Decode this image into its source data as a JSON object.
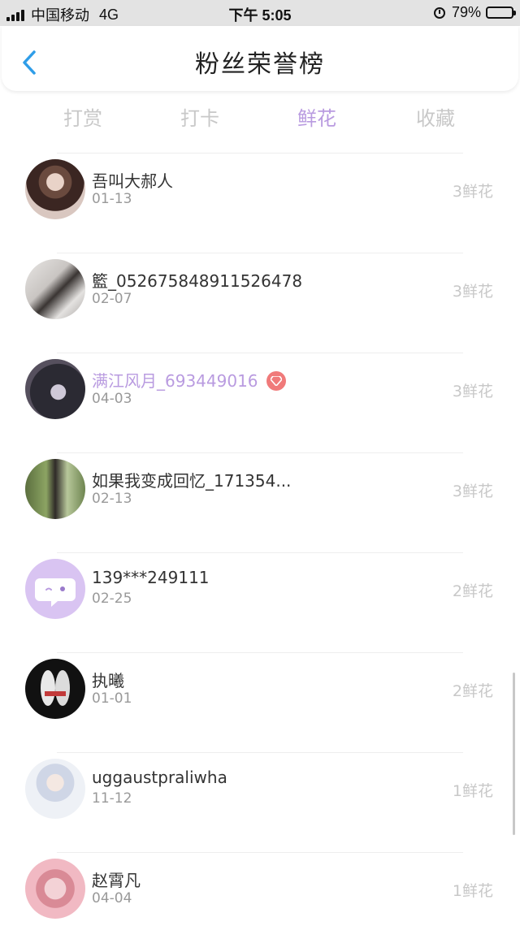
{
  "status_bar": {
    "carrier": "中国移动",
    "network": "4G",
    "time": "下午 5:05",
    "battery_percent": "79%",
    "battery_level": 0.79
  },
  "header": {
    "title": "粉丝荣誉榜",
    "back_icon": "chevron-left-icon",
    "accent_color": "#2f9de8"
  },
  "tabs": [
    {
      "label": "打赏",
      "active": false
    },
    {
      "label": "打卡",
      "active": false
    },
    {
      "label": "鲜花",
      "active": true
    },
    {
      "label": "收藏",
      "active": false
    }
  ],
  "colors": {
    "active_tab": "#b99be0",
    "inactive_text": "#c8c8c8",
    "vip_name": "#b99be0",
    "vip_badge": "#f07a7a"
  },
  "fans": [
    {
      "name": "吾叫大郝人",
      "date": "01-13",
      "count": "3鲜花",
      "vip": false
    },
    {
      "name": "籃_052675848911526478",
      "date": "02-07",
      "count": "3鲜花",
      "vip": false
    },
    {
      "name": "满江风月_693449016",
      "date": "04-03",
      "count": "3鲜花",
      "vip": true
    },
    {
      "name": "如果我变成回忆_171354...",
      "date": "02-13",
      "count": "3鲜花",
      "vip": false
    },
    {
      "name": "139***249111",
      "date": "02-25",
      "count": "2鲜花",
      "vip": false
    },
    {
      "name": "执曦",
      "date": "01-01",
      "count": "2鲜花",
      "vip": false
    },
    {
      "name": "uggaustpraliwha",
      "date": "11-12",
      "count": "1鲜花",
      "vip": false
    },
    {
      "name": "赵霄凡",
      "date": "04-04",
      "count": "1鲜花",
      "vip": false
    }
  ]
}
